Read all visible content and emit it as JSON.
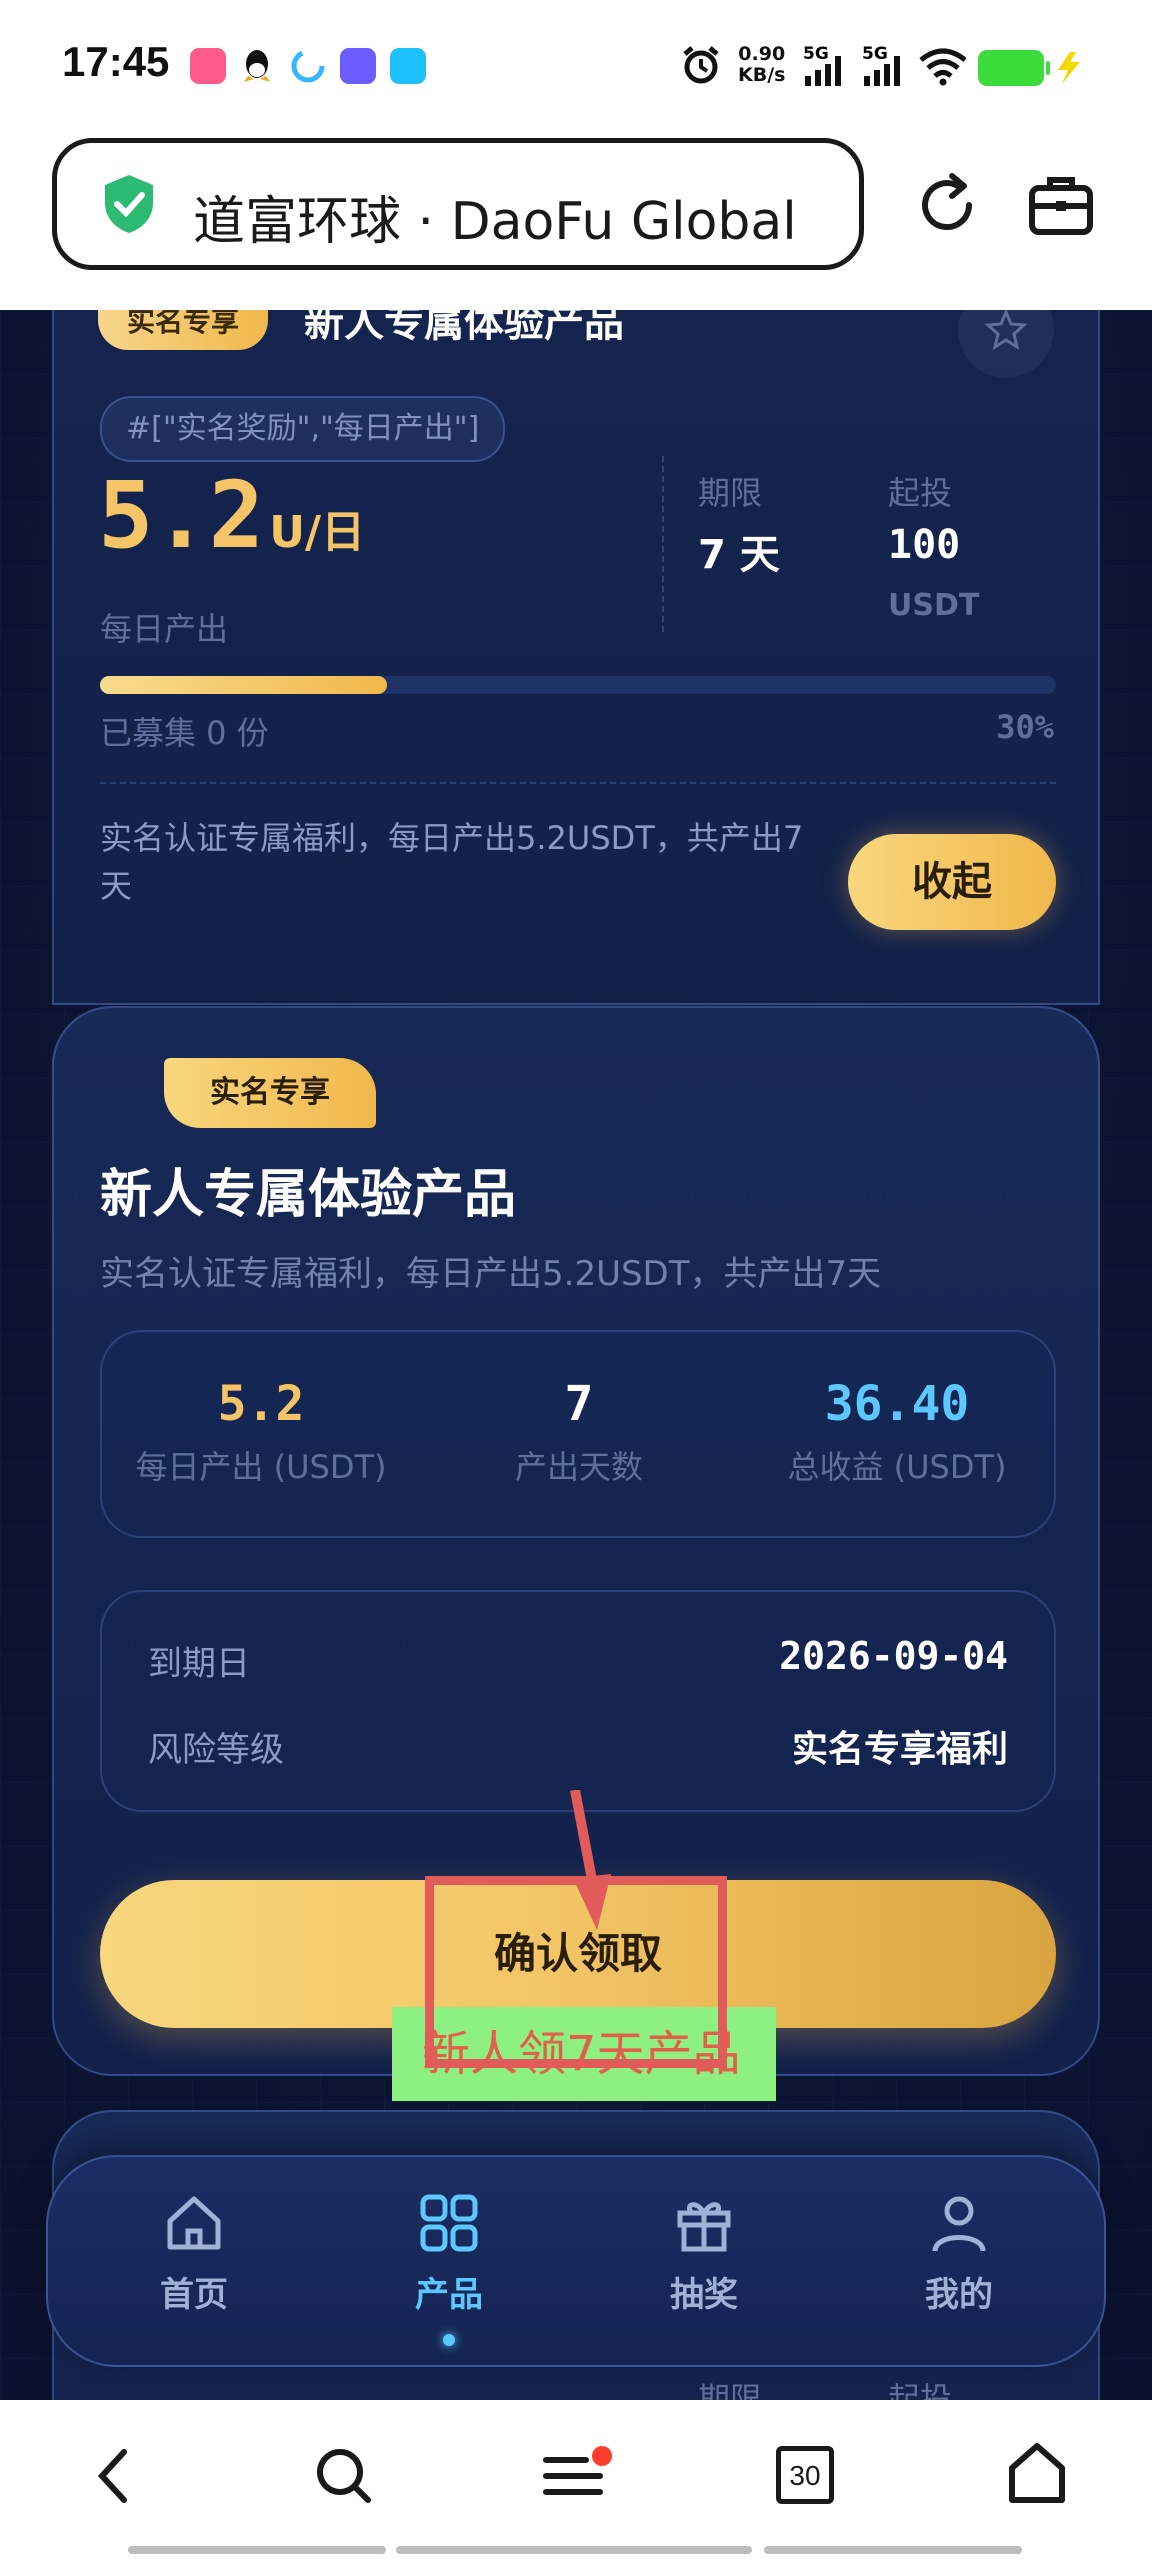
{
  "status_bar": {
    "time": "17:45",
    "net_speed_value": "0.90",
    "net_speed_unit": "KB/s",
    "sim1": "5G",
    "sim2": "5G",
    "battery_color": "#3ddc3d"
  },
  "browser": {
    "url_title": "道富环球 · DaoFu Global",
    "tab_count": "30"
  },
  "product_card_expanded": {
    "badge": "实名专享",
    "title": "新人专属体验产品",
    "tags": "#[\"实名奖励\",\"每日产出\"]",
    "daily_output_value": "5.2",
    "daily_output_unit": "U/日",
    "daily_output_label": "每日产出",
    "term_label": "期限",
    "term_value": "7 天",
    "min_invest_label": "起投",
    "min_invest_value": "100",
    "min_invest_unit": "USDT",
    "progress_percent": 30,
    "raised_text": "已募集 0 份",
    "progress_text": "30%",
    "description": "实名认证专属福利，每日产出5.2USDT，共产出7天",
    "collapse_button": "收起"
  },
  "detail_panel": {
    "badge": "实名专享",
    "title": "新人专属体验产品",
    "description": "实名认证专属福利，每日产出5.2USDT，共产出7天",
    "stats": [
      {
        "value": "5.2",
        "label": "每日产出 (USDT)"
      },
      {
        "value": "7",
        "label": "产出天数"
      },
      {
        "value": "36.40",
        "label": "总收益 (USDT)"
      }
    ],
    "expiry_label": "到期日",
    "expiry_value": "2026-09-04",
    "risk_label": "风险等级",
    "risk_value": "实名专享福利",
    "confirm_button": "确认领取"
  },
  "next_card_peek": {
    "term_label": "期限",
    "min_invest_label": "起投"
  },
  "annotation": {
    "text": "新人领7天产品"
  },
  "bottom_nav": {
    "items": [
      {
        "label": "首页",
        "icon": "home-icon"
      },
      {
        "label": "产品",
        "icon": "grid-icon"
      },
      {
        "label": "抽奖",
        "icon": "gift-icon"
      },
      {
        "label": "我的",
        "icon": "user-icon"
      }
    ],
    "active_index": 1,
    "active_color": "#5cc8ff",
    "inactive_color": "#9fb1d6"
  },
  "colors": {
    "gold": "#f5c466",
    "accent_blue": "#5cc8ff",
    "page_bg": "#0b1533"
  }
}
